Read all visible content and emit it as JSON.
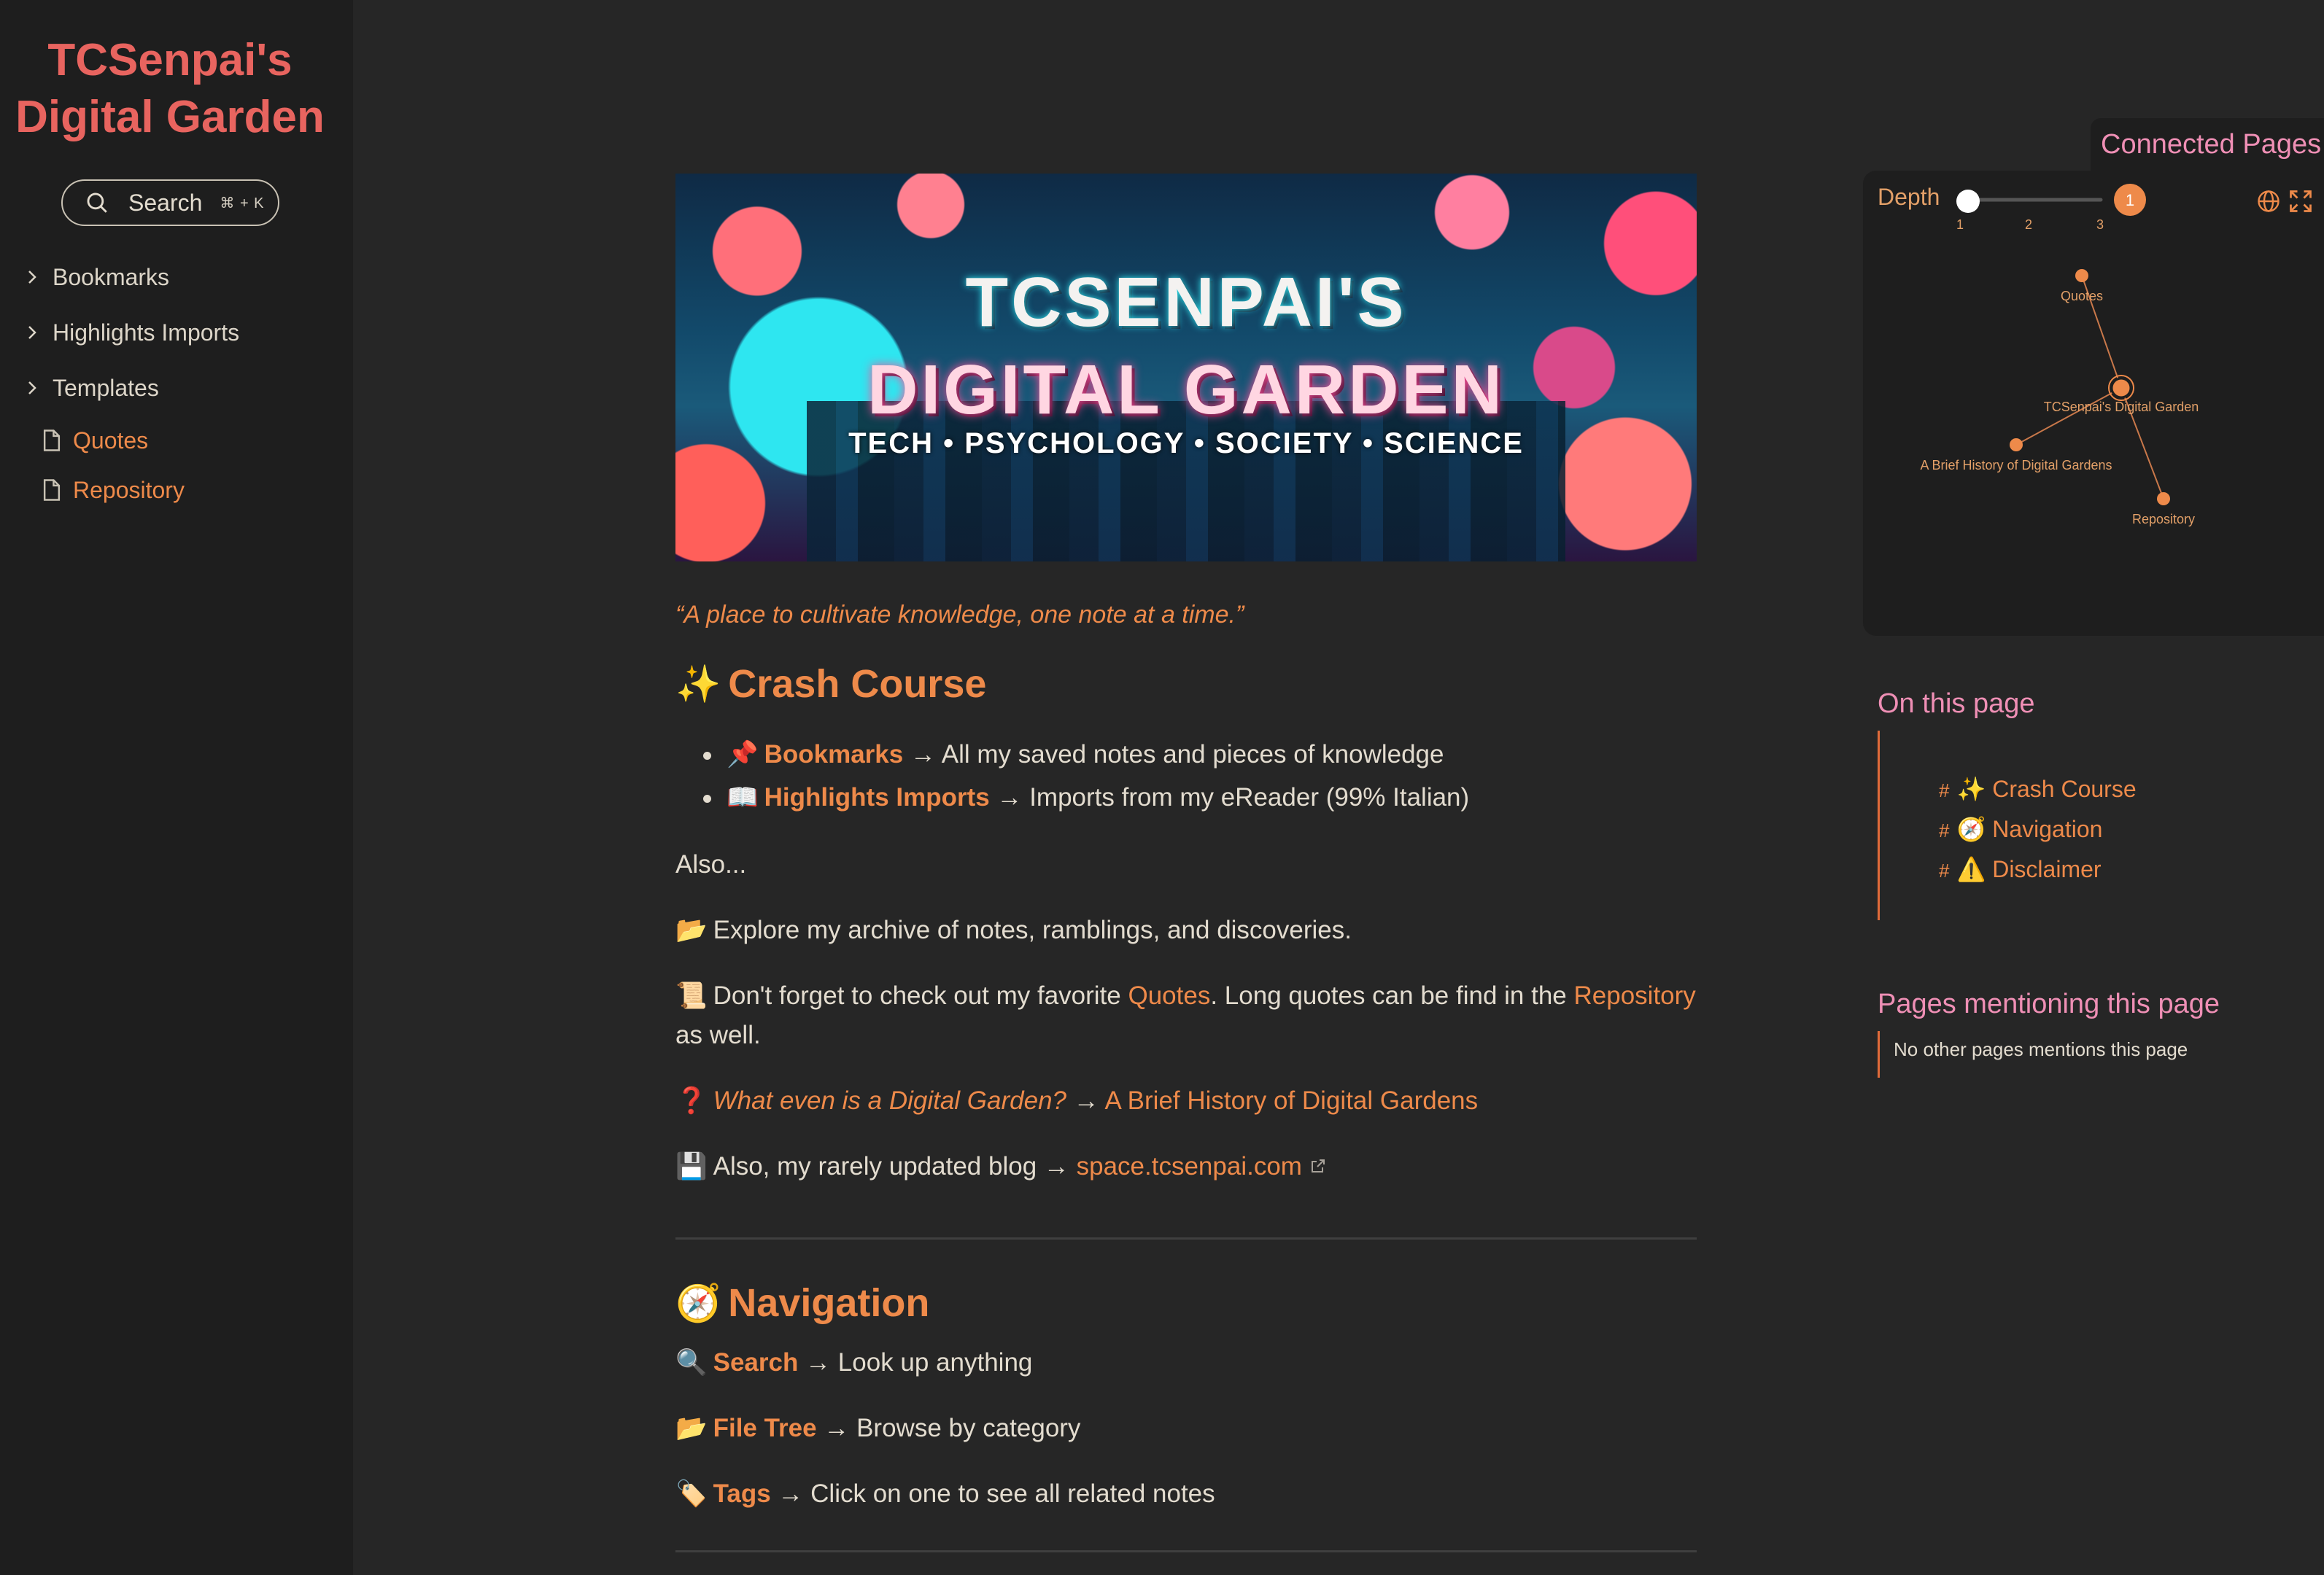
{
  "sidebar": {
    "site_title": "TCSenpai's Digital Garden",
    "search": {
      "label": "Search",
      "shortcut": "⌘ + K"
    },
    "folders": [
      {
        "label": "Bookmarks"
      },
      {
        "label": "Highlights Imports"
      },
      {
        "label": "Templates"
      }
    ],
    "files": [
      {
        "label": "Quotes"
      },
      {
        "label": "Repository"
      }
    ]
  },
  "banner": {
    "line1": "TCSENPAI'S",
    "line2": "DIGITAL GARDEN",
    "line3": "TECH • PSYCHOLOGY  • SOCIETY • SCIENCE"
  },
  "content": {
    "tagline": "“A place to cultivate knowledge, one note at a time.”",
    "crash": {
      "emoji": "✨",
      "heading": "Crash Course",
      "items": [
        {
          "emoji": "📌",
          "link": "Bookmarks",
          "text": " → All my saved notes and pieces of knowledge"
        },
        {
          "emoji": "📖",
          "link": "Highlights Imports",
          "text": " → Imports from my eReader (99% Italian)"
        }
      ]
    },
    "also": "Also...",
    "archive": {
      "emoji": "📂",
      "text": "Explore my archive of notes, ramblings, and discoveries."
    },
    "quotes_line": {
      "emoji": "📜",
      "before": "Don't forget to check out my favorite ",
      "link1": "Quotes",
      "middle": ". Long quotes can be find in the ",
      "link2": "Repository",
      "after": " as well."
    },
    "what_line": {
      "emoji": "❓",
      "question": "What even is a Digital Garden?",
      "arrow": " → ",
      "link": "A Brief History of Digital Gardens"
    },
    "blog_line": {
      "emoji": "💾",
      "text": "Also, my rarely updated blog → ",
      "link": "space.tcsenpai.com"
    },
    "navigation": {
      "emoji": "🧭",
      "heading": "Navigation",
      "items": [
        {
          "emoji": "🔍",
          "link": "Search",
          "text": " → Look up anything"
        },
        {
          "emoji": "📂",
          "link": "File Tree",
          "text": " → Browse by category"
        },
        {
          "emoji": "🏷️",
          "link": "Tags",
          "text": " → Click on one to see all related notes"
        }
      ]
    }
  },
  "graph": {
    "title": "Connected Pages",
    "depth_label": "Depth",
    "depth_value": "1",
    "ticks": [
      "1",
      "2",
      "3"
    ],
    "nodes": [
      {
        "label": "Quotes"
      },
      {
        "label": "TCSenpai's Digital Garden"
      },
      {
        "label": "A Brief History of Digital Gardens"
      },
      {
        "label": "Repository"
      }
    ],
    "accent": "#ee8a4a"
  },
  "toc": {
    "title": "On this page",
    "items": [
      {
        "hash": "#",
        "label": "✨ Crash Course"
      },
      {
        "hash": "#",
        "label": "🧭 Navigation"
      },
      {
        "hash": "#",
        "label": "⚠️ Disclaimer"
      }
    ]
  },
  "mentions": {
    "title": "Pages mentioning this page",
    "empty": "No other pages mentions this page"
  }
}
